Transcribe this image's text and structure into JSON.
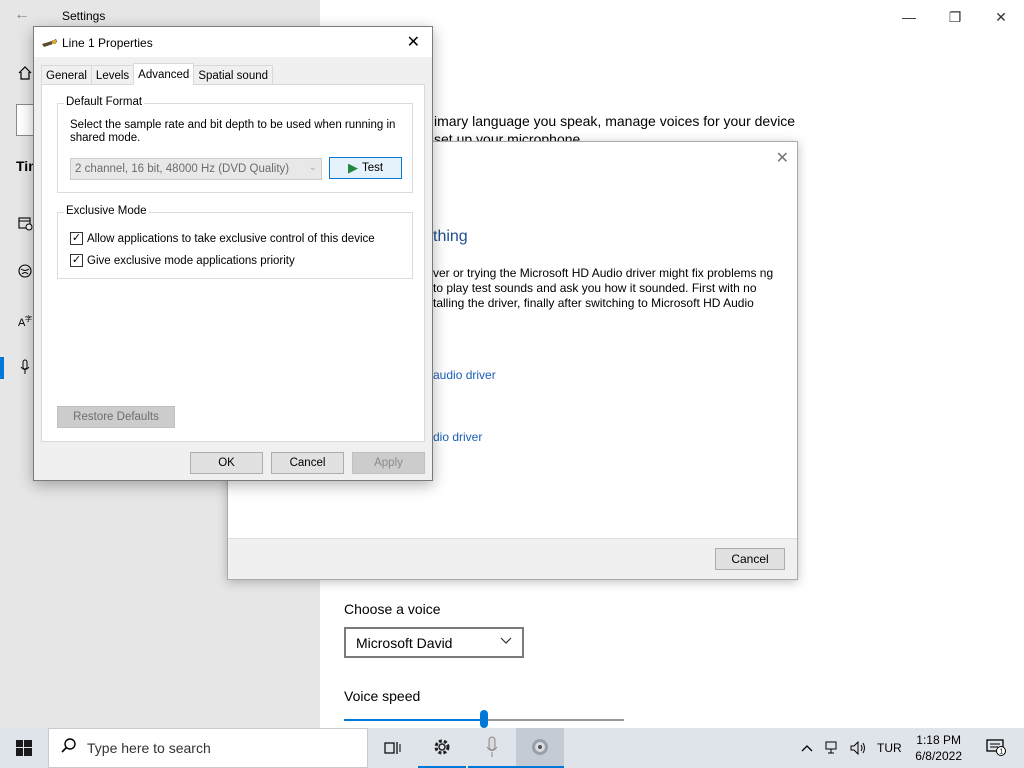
{
  "settings": {
    "title": "Settings",
    "tab_heading_partial": "Tin",
    "intro_line1": "imary language you speak, manage voices for your device",
    "intro_line2": "set up your microphone",
    "choose_voice_label": "Choose a voice",
    "voice_selected": "Microsoft David",
    "voice_speed_label": "Voice speed",
    "voice_speed_fraction": 0.5,
    "window_controls": {
      "minimize": "—",
      "maximize": "❐",
      "close": "✕"
    }
  },
  "troubleshooter": {
    "heading_partial": "thing",
    "paragraph": "ver or trying the Microsoft HD Audio driver might fix problems ng to play test sounds and ask you how it sounded. First with no talling the driver, finally after switching to Microsoft HD Audio",
    "link1": "audio driver",
    "link2": "dio driver",
    "close_glyph": "✕",
    "cancel_label": "Cancel"
  },
  "properties": {
    "title": "Line 1 Properties",
    "close_glyph": "✕",
    "tabs": [
      {
        "label": "General",
        "active": false
      },
      {
        "label": "Levels",
        "active": false
      },
      {
        "label": "Advanced",
        "active": true
      },
      {
        "label": "Spatial sound",
        "active": false
      }
    ],
    "default_format": {
      "group_label": "Default Format",
      "description": "Select the sample rate and bit depth to be used when running in shared mode.",
      "selected_format": "2 channel, 16 bit, 48000 Hz (DVD Quality)",
      "test_label": "Test"
    },
    "exclusive_mode": {
      "group_label": "Exclusive Mode",
      "options": [
        {
          "label": "Allow applications to take exclusive control of this device",
          "checked": true
        },
        {
          "label": "Give exclusive mode applications priority",
          "checked": true
        }
      ]
    },
    "restore_label": "Restore Defaults",
    "ok_label": "OK",
    "cancel_label": "Cancel",
    "apply_label": "Apply"
  },
  "taskbar": {
    "search_placeholder": "Type here to search",
    "language": "TUR",
    "time": "1:18 PM",
    "date": "6/8/2022",
    "notification_count": "1",
    "icons": [
      "task-view-icon",
      "settings-gear-icon",
      "microphone-icon",
      "speaker-icon"
    ]
  },
  "colors": {
    "accent": "#0078d7",
    "link": "#1a5fb4",
    "heading": "#1e4e8c",
    "test_play": "#21873c"
  }
}
